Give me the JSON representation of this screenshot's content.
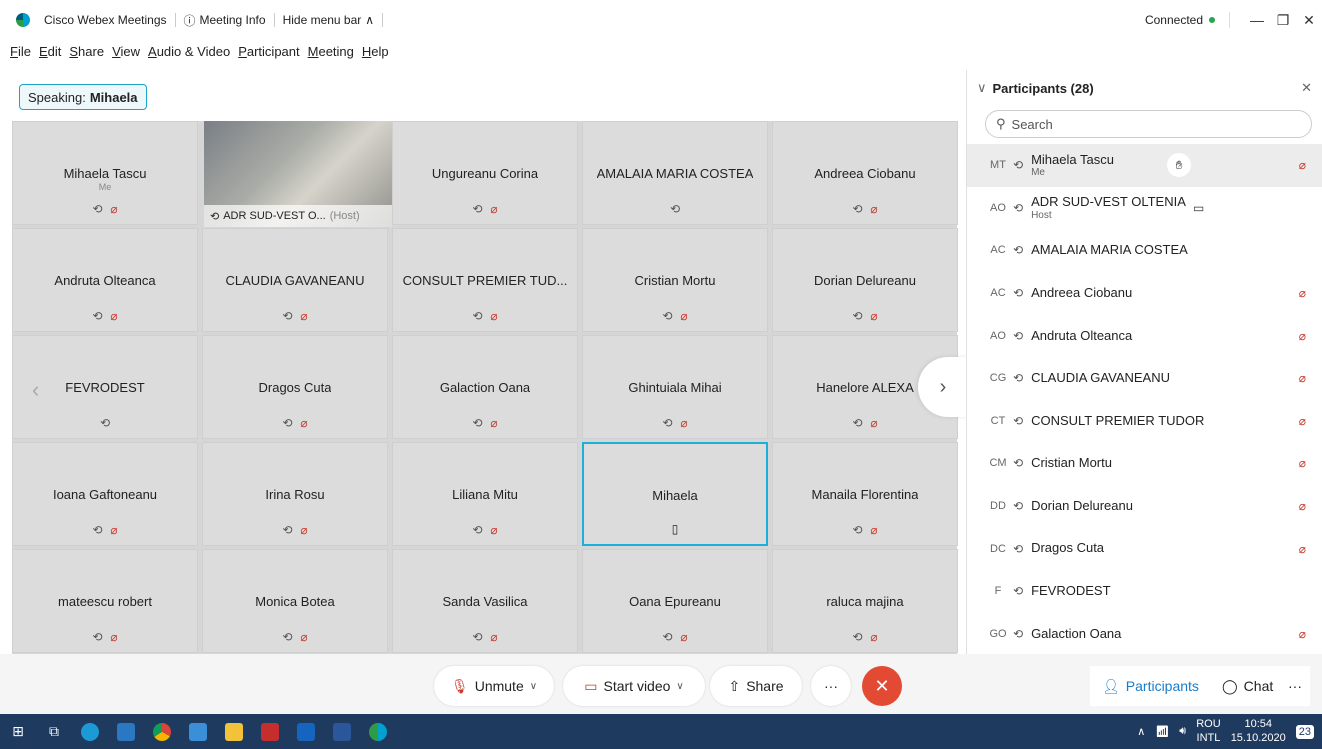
{
  "titlebar": {
    "app_title": "Cisco Webex Meetings",
    "meeting_info": "Meeting Info",
    "hide_menu": "Hide menu bar",
    "status": "Connected"
  },
  "menu": [
    "File",
    "Edit",
    "Share",
    "View",
    "Audio & Video",
    "Participant",
    "Meeting",
    "Help"
  ],
  "speaking": {
    "label": "Speaking:",
    "name": "Mihaela"
  },
  "grid": {
    "video_tile": {
      "name": "ADR SUD-VEST O...",
      "role": "(Host)"
    },
    "cells": [
      {
        "name": "Mihaela Tascu",
        "sub": "Me",
        "mic": true,
        "muted": true
      },
      {
        "name": "Ungureanu Corina",
        "sub": "",
        "mic": true,
        "muted": true
      },
      {
        "name": "AMALAIA MARIA COSTEA",
        "sub": "",
        "mic": true,
        "muted": false
      },
      {
        "name": "Andreea Ciobanu",
        "sub": "",
        "mic": true,
        "muted": true
      },
      {
        "name": "Andruta Olteanca",
        "sub": "",
        "mic": true,
        "muted": true
      },
      {
        "name": "CLAUDIA GAVANEANU",
        "sub": "",
        "mic": true,
        "muted": true
      },
      {
        "name": "CONSULT PREMIER TUD...",
        "sub": "",
        "mic": true,
        "muted": true
      },
      {
        "name": "Cristian Mortu",
        "sub": "",
        "mic": true,
        "muted": true
      },
      {
        "name": "Dorian Delureanu",
        "sub": "",
        "mic": true,
        "muted": true
      },
      {
        "name": "FEVRODEST",
        "sub": "",
        "mic": true,
        "muted": false
      },
      {
        "name": "Dragos Cuta",
        "sub": "",
        "mic": true,
        "muted": true
      },
      {
        "name": "Galaction Oana",
        "sub": "",
        "mic": true,
        "muted": true
      },
      {
        "name": "Ghintuiala Mihai",
        "sub": "",
        "mic": true,
        "muted": true
      },
      {
        "name": "Hanelore ALEXA",
        "sub": "",
        "mic": true,
        "muted": true
      },
      {
        "name": "Ioana Gaftoneanu",
        "sub": "",
        "mic": true,
        "muted": true
      },
      {
        "name": "Irina Rosu",
        "sub": "",
        "mic": true,
        "muted": true
      },
      {
        "name": "Liliana Mitu",
        "sub": "",
        "mic": true,
        "muted": true
      },
      {
        "name": "Mihaela",
        "sub": "",
        "mic": false,
        "muted": false,
        "phone": true
      },
      {
        "name": "Manaila Florentina",
        "sub": "",
        "mic": true,
        "muted": true
      },
      {
        "name": "mateescu robert",
        "sub": "",
        "mic": true,
        "muted": true
      },
      {
        "name": "Monica Botea",
        "sub": "",
        "mic": true,
        "muted": true
      },
      {
        "name": "Sanda Vasilica",
        "sub": "",
        "mic": true,
        "muted": true
      },
      {
        "name": "Oana Epureanu",
        "sub": "",
        "mic": true,
        "muted": true
      },
      {
        "name": "raluca majina",
        "sub": "",
        "mic": true,
        "muted": true
      }
    ]
  },
  "panel": {
    "title": "Participants (28)",
    "search_placeholder": "Search",
    "participants": [
      {
        "initials": "MT",
        "name": "Mihaela Tascu",
        "role": "Me",
        "muted": true,
        "hand": true,
        "selected": true
      },
      {
        "initials": "AO",
        "name": "ADR SUD-VEST OLTENIA",
        "role": "Host",
        "muted": false,
        "camera": true
      },
      {
        "initials": "AC",
        "name": "AMALAIA MARIA COSTEA",
        "role": "",
        "muted": false
      },
      {
        "initials": "AC",
        "name": "Andreea Ciobanu",
        "role": "",
        "muted": true
      },
      {
        "initials": "AO",
        "name": "Andruta Olteanca",
        "role": "",
        "muted": true
      },
      {
        "initials": "CG",
        "name": "CLAUDIA GAVANEANU",
        "role": "",
        "muted": true
      },
      {
        "initials": "CT",
        "name": "CONSULT PREMIER TUDOR",
        "role": "",
        "muted": true
      },
      {
        "initials": "CM",
        "name": "Cristian Mortu",
        "role": "",
        "muted": true
      },
      {
        "initials": "DD",
        "name": "Dorian Delureanu",
        "role": "",
        "muted": true
      },
      {
        "initials": "DC",
        "name": "Dragos Cuta",
        "role": "",
        "muted": true
      },
      {
        "initials": "F",
        "name": "FEVRODEST",
        "role": "",
        "muted": false
      },
      {
        "initials": "GO",
        "name": "Galaction Oana",
        "role": "",
        "muted": true
      }
    ]
  },
  "controls": {
    "unmute": "Unmute",
    "start_video": "Start video",
    "share": "Share",
    "more": "···",
    "participants": "Participants",
    "chat": "Chat"
  },
  "taskbar": {
    "lang_top": "ROU",
    "lang_bottom": "INTL",
    "time": "10:54",
    "date": "15.10.2020",
    "notifications": "23"
  },
  "colors": {
    "accent": "#1ab1d9",
    "mute": "#c63a2c",
    "end": "#e24a33",
    "taskbar": "#1f3a5f"
  }
}
